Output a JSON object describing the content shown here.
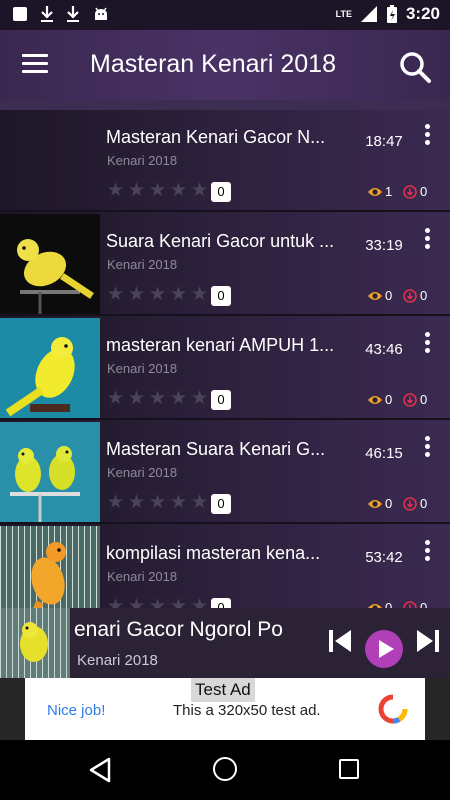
{
  "status_bar": {
    "time": "3:20",
    "network": "LTE",
    "icons": [
      "notification-square-icon",
      "download-icon",
      "download-icon",
      "android-icon",
      "lte-signal-icon",
      "battery-charging-icon"
    ]
  },
  "app_bar": {
    "title": "Masteran Kenari 2018",
    "menu_icon": "hamburger-menu-icon",
    "search_icon": "search-icon"
  },
  "videos": [
    {
      "title": "Masteran Kenari Gacor N...",
      "channel": "Kenari 2018",
      "duration": "18:47",
      "rating": "0",
      "views": "1",
      "dislikes": "0",
      "has_thumbnail": false
    },
    {
      "title": "Suara Kenari Gacor untuk ...",
      "channel": "Kenari 2018",
      "duration": "33:19",
      "rating": "0",
      "views": "0",
      "dislikes": "0",
      "has_thumbnail": true
    },
    {
      "title": "masteran kenari AMPUH 1...",
      "channel": "Kenari 2018",
      "duration": "43:46",
      "rating": "0",
      "views": "0",
      "dislikes": "0",
      "has_thumbnail": true
    },
    {
      "title": "Masteran Suara Kenari G...",
      "channel": "Kenari 2018",
      "duration": "46:15",
      "rating": "0",
      "views": "0",
      "dislikes": "0",
      "has_thumbnail": true
    },
    {
      "title": "kompilasi masteran kena...",
      "channel": "Kenari 2018",
      "duration": "53:42",
      "rating": "0",
      "views": "0",
      "dislikes": "0",
      "has_thumbnail": true
    }
  ],
  "player": {
    "title": "enari Gacor Ngorol Po",
    "channel": "Kenari 2018"
  },
  "ad": {
    "label": "Test Ad",
    "nice": "Nice job!",
    "text": "This a 320x50 test ad."
  },
  "colors": {
    "accent_play": "#b13fb8",
    "views_icon": "#f0a020",
    "dislike_icon": "#e0304a",
    "app_bar": "#4a3266"
  }
}
